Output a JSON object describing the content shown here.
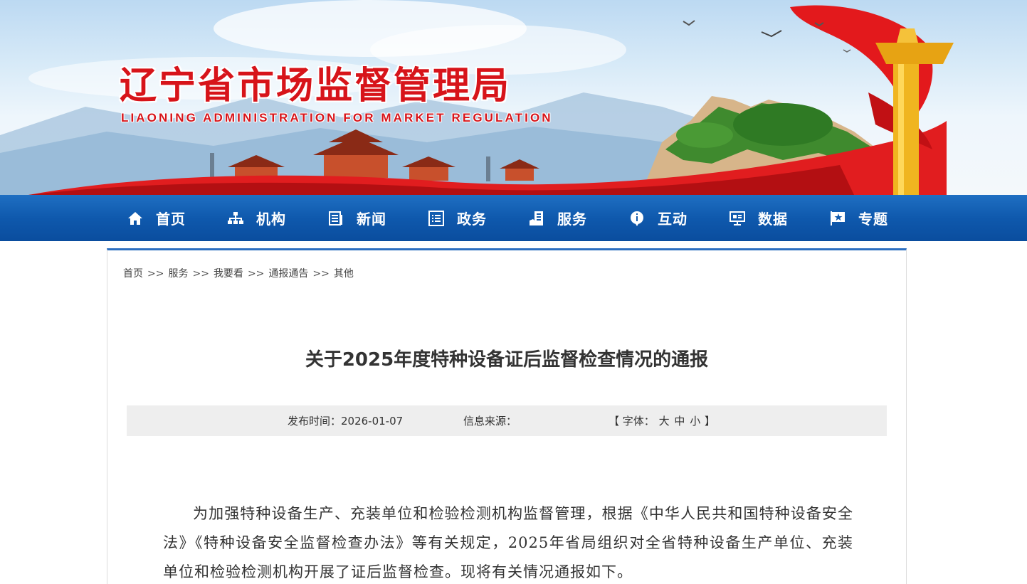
{
  "banner": {
    "title": "辽宁省市场监督管理局",
    "subtitle": "LIAONING ADMINISTRATION FOR MARKET REGULATION"
  },
  "nav": {
    "items": [
      {
        "label": "首页",
        "icon": "home-icon"
      },
      {
        "label": "机构",
        "icon": "org-chart-icon"
      },
      {
        "label": "新闻",
        "icon": "news-icon"
      },
      {
        "label": "政务",
        "icon": "list-icon"
      },
      {
        "label": "服务",
        "icon": "service-icon"
      },
      {
        "label": "互动",
        "icon": "info-icon"
      },
      {
        "label": "数据",
        "icon": "data-screen-icon"
      },
      {
        "label": "专题",
        "icon": "star-flag-icon"
      }
    ]
  },
  "breadcrumb": {
    "items": [
      "首页",
      "服务",
      "我要看",
      "通报通告",
      "其他"
    ],
    "separator": ">>"
  },
  "article": {
    "title": "关于2025年度特种设备证后监督检查情况的通报",
    "date_label": "发布时间：2026-01-07",
    "source_label": "信息来源：",
    "font_size": {
      "open": "【",
      "label": "字体：",
      "large": "大",
      "medium": "中",
      "small": "小",
      "close": "】"
    },
    "body": "为加强特种设备生产、充装单位和检验检测机构监督管理，根据《中华人民共和国特种设备安全法》《特种设备安全监督检查办法》等有关规定，2025年省局组织对全省特种设备生产单位、充装单位和检验检测机构开展了证后监督检查。现将有关情况通报如下。"
  },
  "colors": {
    "brand_red": "#d7141a",
    "nav_blue": "#0f59ad",
    "panel_top_border": "#2d6fc0",
    "meta_bar_bg": "#eeeeee"
  }
}
